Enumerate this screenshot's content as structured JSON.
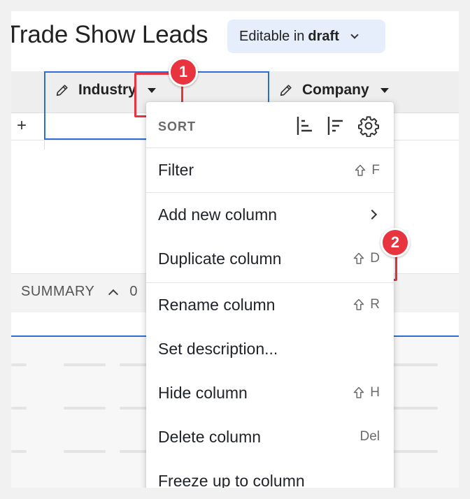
{
  "page": {
    "title": "Trade Show Leads"
  },
  "status": {
    "prefix": "Editable in",
    "emphasis": "draft"
  },
  "columns": [
    {
      "label": "Industry"
    },
    {
      "label": "Company"
    }
  ],
  "add_row": "+",
  "summary": {
    "label": "SUMMARY",
    "count": "0"
  },
  "menu": {
    "sort_label": "SORT",
    "items": [
      {
        "label": "Filter",
        "shortcut": "F",
        "shift": true
      },
      {
        "label": "Add new column",
        "submenu": true
      },
      {
        "label": "Duplicate column",
        "shortcut": "D",
        "shift": true
      },
      {
        "label": "Rename column",
        "shortcut": "R",
        "shift": true
      },
      {
        "label": "Set description..."
      },
      {
        "label": "Hide column",
        "shortcut": "H",
        "shift": true
      },
      {
        "label": "Delete column",
        "shortcut": "Del"
      },
      {
        "label": "Freeze up to column"
      }
    ]
  },
  "callouts": [
    {
      "number": "1"
    },
    {
      "number": "2"
    }
  ],
  "colors": {
    "accent": "#2c6ed1",
    "callout": "#e8343f",
    "status_bg": "#e6eefc"
  },
  "icons": [
    "pencil-icon",
    "caret-down-icon",
    "sort-ascending-icon",
    "sort-descending-icon",
    "gear-icon",
    "shift-icon",
    "chevron-right-icon",
    "chevron-up-icon",
    "chevron-down-icon"
  ]
}
